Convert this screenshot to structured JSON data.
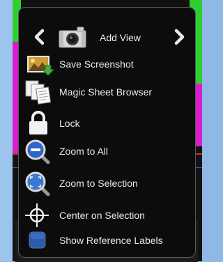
{
  "menu": {
    "nav": {
      "prev_icon": "chevron-left-icon",
      "view_icon": "camera-icon",
      "label": "Add View",
      "next_icon": "chevron-right-icon"
    },
    "items": [
      {
        "label": "Save Screenshot",
        "icon": "screenshot-save-icon"
      },
      {
        "label": "Magic Sheet Browser",
        "icon": "documents-icon"
      },
      {
        "label": "Lock",
        "icon": "padlock-icon"
      },
      {
        "label": "Zoom to All",
        "icon": "zoom-out-icon"
      },
      {
        "label": "Zoom to Selection",
        "icon": "zoom-selection-icon"
      },
      {
        "label": "Center on Selection",
        "icon": "crosshair-icon"
      },
      {
        "label": "Show Reference Labels",
        "icon": "checkbox-icon"
      }
    ]
  },
  "colors": {
    "menu_bg": "#0c0c0c",
    "text": "#eaeaea",
    "magenta": "#d81ecc",
    "green": "#2fcf2f",
    "desktop_blue": "#8fb8e6"
  }
}
